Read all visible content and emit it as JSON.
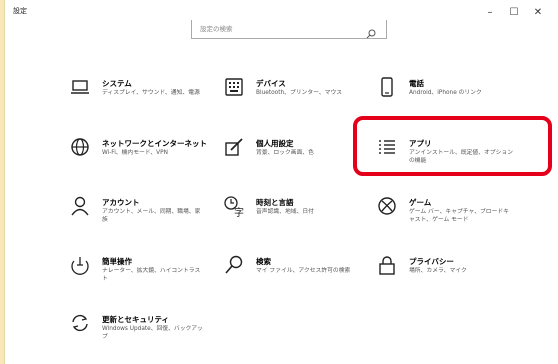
{
  "window": {
    "title": "設定",
    "minimize": "–",
    "maximize": "☐",
    "close": "✕"
  },
  "search": {
    "placeholder": "設定の検索"
  },
  "tiles": [
    {
      "name": "システム",
      "desc": "ディスプレイ、サウンド、通知、電源",
      "icon": "laptop-icon"
    },
    {
      "name": "デバイス",
      "desc": "Bluetooth、プリンター、マウス",
      "icon": "keyboard-icon"
    },
    {
      "name": "電話",
      "desc": "Android、iPhone のリンク",
      "icon": "phone-icon"
    },
    {
      "name": "ネットワークとインターネット",
      "desc": "Wi-Fi、機内モード、VPN",
      "icon": "globe-icon"
    },
    {
      "name": "個人用設定",
      "desc": "背景、ロック画面、色",
      "icon": "paint-icon"
    },
    {
      "name": "アプリ",
      "desc": "アンインストール、既定値、オプションの機能",
      "icon": "apps-list-icon"
    },
    {
      "name": "アカウント",
      "desc": "アカウント、メール、同期、職場、家族",
      "icon": "person-icon"
    },
    {
      "name": "時刻と言語",
      "desc": "音声認識、地域、日付",
      "icon": "time-language-icon"
    },
    {
      "name": "ゲーム",
      "desc": "ゲーム バー、キャプチャ、ブロードキャスト、ゲーム モード",
      "icon": "xbox-icon"
    },
    {
      "name": "簡単操作",
      "desc": "ナレーター、拡大鏡、ハイコントラスト",
      "icon": "ease-of-access-icon"
    },
    {
      "name": "検索",
      "desc": "マイ ファイル、アクセス許可の検索",
      "icon": "search-icon"
    },
    {
      "name": "プライバシー",
      "desc": "場所、カメラ、マイク",
      "icon": "lock-icon"
    },
    {
      "name": "更新とセキュリティ",
      "desc": "Windows Update、回復、バックアップ",
      "icon": "update-icon"
    }
  ],
  "colors": {
    "accent": "#e4001a",
    "icon": "#222222",
    "desktop": "#f7e7b9"
  }
}
